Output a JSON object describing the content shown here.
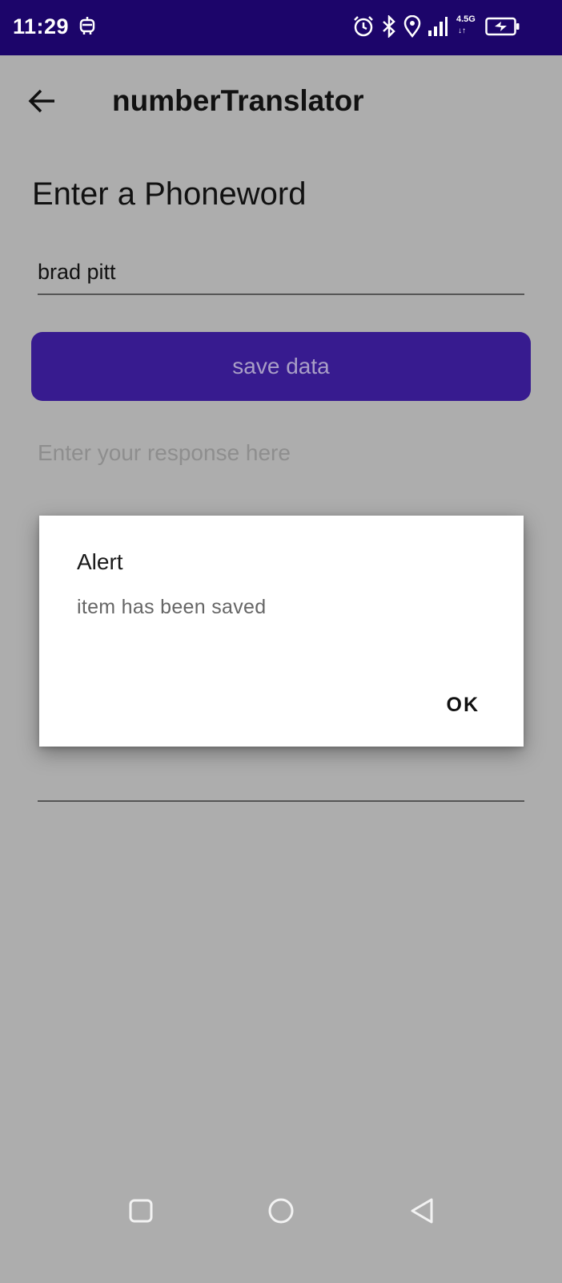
{
  "status_bar": {
    "time": "11:29",
    "network_type": "4.5G",
    "network_arrows": "↓↑",
    "icons": [
      "robot-icon",
      "alarm-icon",
      "bluetooth-icon",
      "location-icon",
      "signal-icon",
      "battery-charging-icon"
    ]
  },
  "toolbar": {
    "back_icon": "arrow-back-icon",
    "title": "numberTranslator"
  },
  "form": {
    "heading": "Enter a Phoneword",
    "phoneword_value": "brad pitt",
    "save_label": "save data",
    "response_placeholder": "Enter your response here"
  },
  "dialog": {
    "title": "Alert",
    "message": "item has been saved",
    "ok_label": "OK"
  },
  "nav_bar": {
    "icons": [
      "recent-apps-icon",
      "home-icon",
      "back-icon"
    ]
  },
  "colors": {
    "status_bar": "#1c056a",
    "accent": "#371b8f",
    "scrim_background": "#adadad",
    "dialog_background": "#ffffff"
  }
}
